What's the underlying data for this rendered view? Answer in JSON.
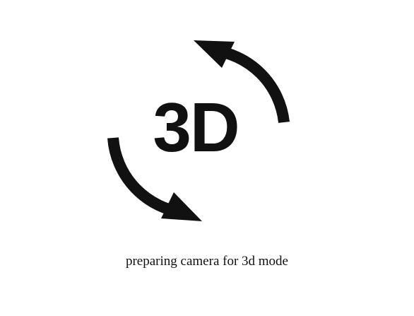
{
  "loading_screen": {
    "icon": "rotate-3d-icon",
    "badge_text": "3D",
    "status_message": "preparing camera for 3d mode",
    "colors": {
      "foreground": "#111111",
      "background": "#ffffff"
    }
  }
}
